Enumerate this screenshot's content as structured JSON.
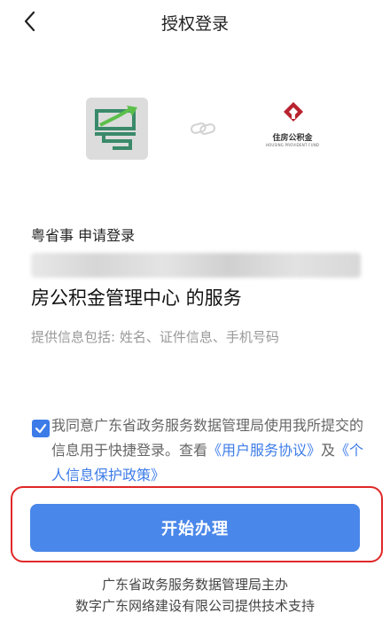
{
  "nav": {
    "title": "授权登录"
  },
  "logos": {
    "fund_name": "住房公积金",
    "fund_sub": "HOUSING PROVIDENT FUND"
  },
  "auth": {
    "request_line": "粤省事 申请登录",
    "service_line": "房公积金管理中心 的服务",
    "info_line": "提供信息包括: 姓名、证件信息、手机号码"
  },
  "consent": {
    "checked": true,
    "prefix": "我同意广东省政务服务数据管理局使用我所提交的信息用于快捷登录。查看",
    "link1": "《用户服务协议》",
    "middle": "及",
    "link2": "《个人信息保护政策》"
  },
  "action": {
    "start_label": "开始办理"
  },
  "footer": {
    "line1": "广东省政务服务数据管理局主办",
    "line2": "数字广东网络建设有限公司提供技术支持"
  },
  "colors": {
    "accent": "#4a87ea",
    "link": "#3d7ce8",
    "highlight": "#e02828",
    "fund_red": "#b8232f"
  }
}
